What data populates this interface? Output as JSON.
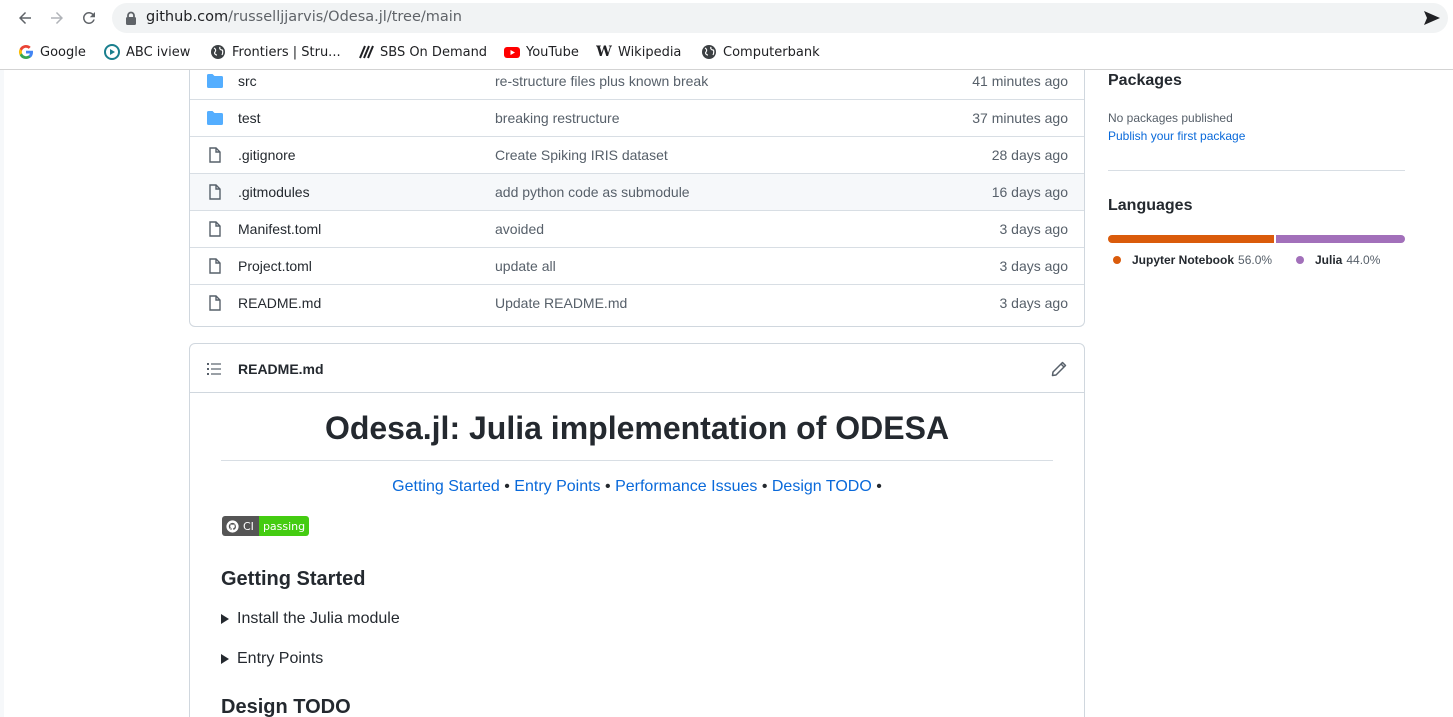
{
  "browser": {
    "url_host": "github.com",
    "url_path": "/russelljjarvis/Odesa.jl/tree/main",
    "bookmarks": [
      {
        "label": "Google",
        "icon": "google-icon"
      },
      {
        "label": "ABC iview",
        "icon": "abc-iview-icon"
      },
      {
        "label": "Frontiers | Stru...",
        "icon": "globe-icon"
      },
      {
        "label": "SBS On Demand",
        "icon": "sbs-icon"
      },
      {
        "label": "YouTube",
        "icon": "youtube-icon"
      },
      {
        "label": "Wikipedia",
        "icon": "wikipedia-icon"
      },
      {
        "label": "Computerbank",
        "icon": "globe-icon"
      }
    ]
  },
  "files": [
    {
      "type": "dir",
      "name": "src",
      "message": "re-structure files plus known break",
      "time": "41 minutes ago"
    },
    {
      "type": "dir",
      "name": "test",
      "message": "breaking restructure",
      "time": "37 minutes ago"
    },
    {
      "type": "file",
      "name": ".gitignore",
      "message": "Create Spiking IRIS dataset",
      "time": "28 days ago"
    },
    {
      "type": "file",
      "name": ".gitmodules",
      "message": "add python code as submodule",
      "time": "16 days ago"
    },
    {
      "type": "file",
      "name": "Manifest.toml",
      "message": "avoided",
      "time": "3 days ago"
    },
    {
      "type": "file",
      "name": "Project.toml",
      "message": "update all",
      "time": "3 days ago"
    },
    {
      "type": "file",
      "name": "README.md",
      "message": "Update README.md",
      "time": "3 days ago"
    }
  ],
  "readme": {
    "header": "README.md",
    "title": "Odesa.jl: Julia implementation of ODESA",
    "links": [
      "Getting Started",
      "Entry Points",
      "Performance Issues",
      "Design TODO"
    ],
    "separator": "•",
    "badge_left": "CI",
    "badge_right": "passing",
    "h2_getting_started": "Getting Started",
    "summary_install": "Install the Julia module",
    "summary_entry": "Entry Points",
    "h2_design": "Design TODO"
  },
  "sidebar": {
    "packages_title": "Packages",
    "packages_none": "No packages published",
    "packages_link": "Publish your first package",
    "languages_title": "Languages",
    "languages": [
      {
        "name": "Jupyter Notebook",
        "percent": "56.0%",
        "value": 56.0,
        "color": "#DA5B0B"
      },
      {
        "name": "Julia",
        "percent": "44.0%",
        "value": 44.0,
        "color": "#a270ba"
      }
    ]
  },
  "colors": {
    "link": "#0969da",
    "folder": "#54aeff",
    "badge_pass": "#44cc11"
  }
}
